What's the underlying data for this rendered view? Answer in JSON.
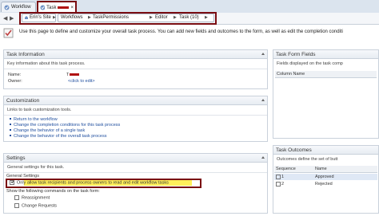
{
  "tabs": [
    {
      "label": "Workflow"
    },
    {
      "label": "Task "
    }
  ],
  "breadcrumb": {
    "site": "Erin's Site",
    "trail": [
      "Workflows",
      "TaskPermissions",
      "Editor",
      "Task (10)"
    ]
  },
  "intro": "Use this page to define and customize your overall task process. You can add new fields and outcomes to the form, as well as edit the completion conditi",
  "task_information": {
    "title": "Task Information",
    "subtitle": "Key information about this task process.",
    "name_label": "Name:",
    "name_value": "T",
    "owner_label": "Owner:",
    "owner_value": "<click to edit>"
  },
  "customization": {
    "title": "Customization",
    "subtitle": "Links to task customization tools.",
    "links": [
      "Return to the workflow",
      "Change the completion conditions for this task process",
      "Change the behavior of a single task",
      "Change the behavior of the overall task process"
    ]
  },
  "settings": {
    "title": "Settings",
    "subtitle": "General settings for this task.",
    "general_label": "General Settings",
    "permission_option": "Only allow task recipients and process owners to read and edit workflow tasks",
    "commands_label": "Show the following commands on the task form:",
    "commands": [
      {
        "label": "Reassignment",
        "checked": false
      },
      {
        "label": "Change Requests",
        "checked": false
      }
    ]
  },
  "task_form_fields": {
    "title": "Task Form Fields",
    "subtitle": "Fields displayed on the task comp",
    "column": "Column Name"
  },
  "task_outcomes": {
    "title": "Task Outcomes",
    "subtitle": "Outcomes define the set of butt",
    "columns": [
      "Sequence",
      "Name"
    ],
    "rows": [
      {
        "sequence": "1",
        "name": "Approved"
      },
      {
        "sequence": "2",
        "name": "Rejected"
      }
    ]
  },
  "colors": {
    "accent_link": "#1f4e9e",
    "highlight": "#ffef5a",
    "annotation_box": "#7a0d12"
  }
}
